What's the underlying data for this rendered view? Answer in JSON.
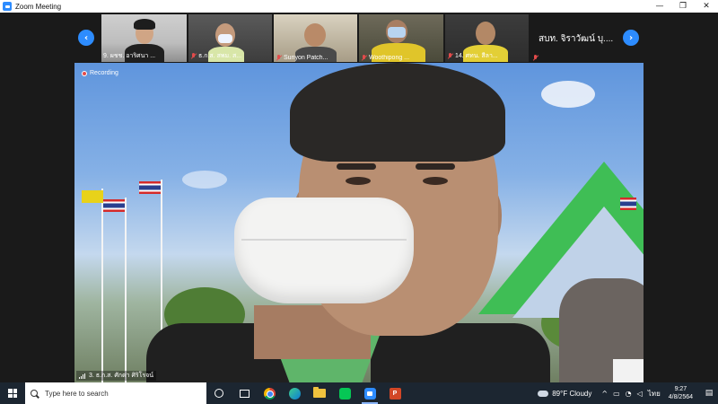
{
  "window": {
    "title": "Zoom Meeting",
    "minimize": "—",
    "maximize": "❐",
    "close": "✕"
  },
  "gallery": {
    "prev_arrow": "‹",
    "next_arrow": "›",
    "participants": [
      {
        "name": "9. ผชช. อาริศนา ..."
      },
      {
        "name": "ธ.ก.ส. สพม. ส..."
      },
      {
        "name": "Suriyon Patch..."
      },
      {
        "name": "Woothipong ..."
      },
      {
        "name": "14. ศทน. สีลา..."
      },
      {
        "name": "สบท. จิราวัฒน์ บุ...."
      }
    ]
  },
  "main_video": {
    "recording_label": "Recording",
    "speaker_name": "3. ธ.ก.ส. ศักดา ศิริโรจน์"
  },
  "taskbar": {
    "search_placeholder": "Type here to search",
    "apps": [
      "cortana-icon",
      "task-view-icon",
      "chrome-icon",
      "edge-icon",
      "file-explorer-icon",
      "line-icon",
      "zoom-icon",
      "powerpoint-icon"
    ],
    "weather_temp": "89°F",
    "weather_desc": "Cloudy",
    "language": "ไทย",
    "time": "9:27",
    "date": "4/8/2564"
  },
  "colors": {
    "zoom_blue": "#2d8cff",
    "taskbar": "#1c2631",
    "recording_red": "#e34b4b"
  }
}
